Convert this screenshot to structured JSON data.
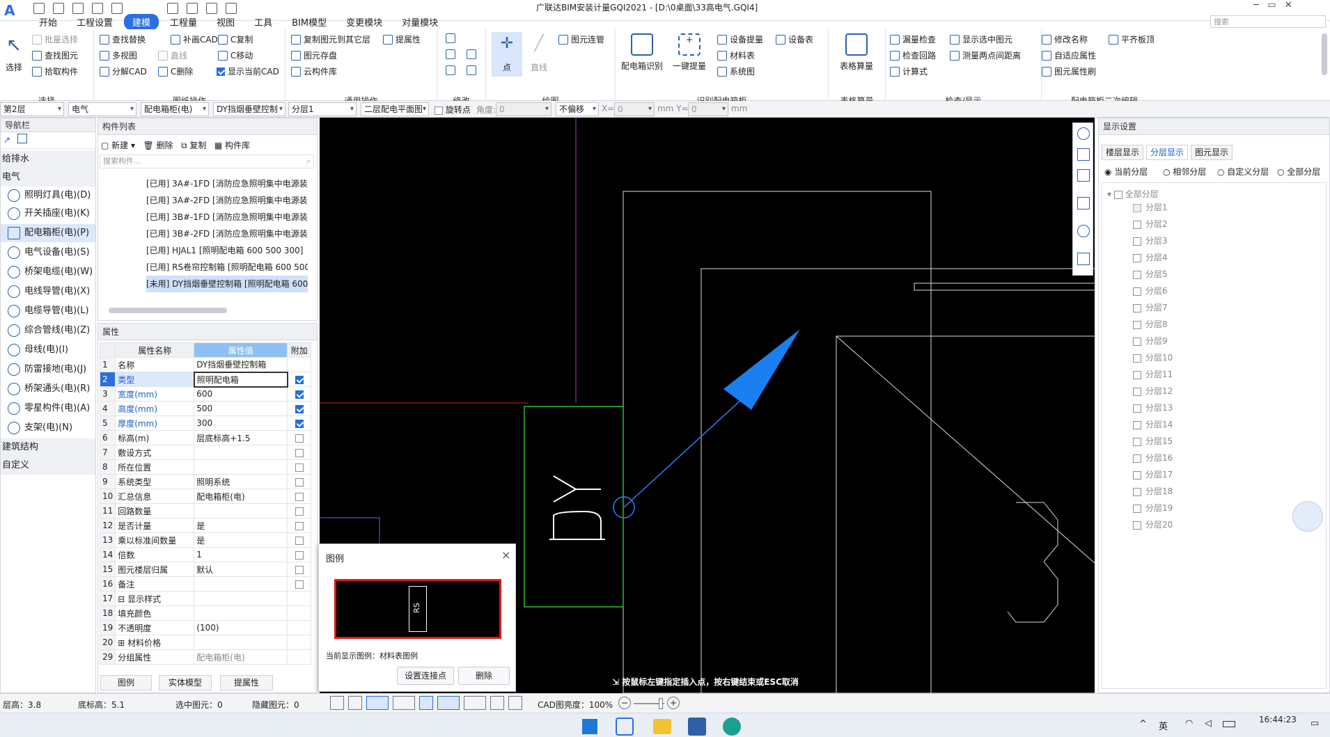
{
  "app": {
    "title": "广联达BIM安装计量GQI2021 - [D:\\0桌面\\33高电气.GQI4]",
    "search_placeholder": "搜索"
  },
  "menu": [
    "开始",
    "工程设置",
    "建模",
    "工程量",
    "视图",
    "工具",
    "BIM模型",
    "变更模块",
    "对量模块"
  ],
  "ribbon": {
    "select": {
      "big": "选择",
      "items": [
        "批量选择",
        "查找图元",
        "拾取构件"
      ],
      "label": "选择"
    },
    "drawing_ops": {
      "items": [
        "查找替换",
        "补画CAD",
        "C复制",
        "多视图",
        "直线",
        "C移动",
        "分解CAD",
        "C删除",
        "显示当前CAD"
      ],
      "label": "图纸操作"
    },
    "common_ops": {
      "items": [
        "复制图元到其它层",
        "提属性",
        "图元存盘",
        "云构件库"
      ],
      "label": "通用操作"
    },
    "modify": {
      "label": "修改"
    },
    "draw": {
      "point": "点",
      "line": "直线",
      "connect": "图元连管",
      "label": "绘图"
    },
    "identify": {
      "big1": "配电箱识别",
      "big2": "一键提量",
      "items": [
        "设备提量",
        "设备表",
        "材料表",
        "系统图"
      ],
      "label": "识别配电箱柜"
    },
    "table_calc": {
      "big": "表格算量",
      "label": "表格算量"
    },
    "check": {
      "items": [
        "漏量检查",
        "显示选中图元",
        "检查回路",
        "测量两点间距离",
        "计算式"
      ],
      "label": "检查/显示"
    },
    "edit2": {
      "items": [
        "修改名称",
        "平齐板顶",
        "自适应属性",
        "图元属性刷"
      ],
      "label": "配电箱柜二次编辑"
    }
  },
  "options": {
    "floor": "第2层",
    "discipline": "电气",
    "type": "配电箱柜(电)",
    "component": "DY挡烟垂壁控制",
    "layer": "分层1",
    "view": "二层配电平面图",
    "rotate_point": "旋转点",
    "angle_label": "角度:",
    "angle": "0",
    "offset": "不偏移",
    "x_label": "X=",
    "x": "0",
    "y_label": "mm Y=",
    "y": "0",
    "unit": "mm"
  },
  "nav": {
    "title": "导航栏",
    "groups": [
      "给排水",
      "电气",
      "建筑结构",
      "自定义"
    ],
    "items": [
      "照明灯具(电)(D)",
      "开关插座(电)(K)",
      "配电箱柜(电)(P)",
      "电气设备(电)(S)",
      "桥架电缆(电)(W)",
      "电线导管(电)(X)",
      "电缆导管(电)(L)",
      "综合管线(电)(Z)",
      "母线(电)(I)",
      "防雷接地(电)(J)",
      "桥架通头(电)(R)",
      "零星构件(电)(A)",
      "支架(电)(N)"
    ]
  },
  "components": {
    "title": "构件列表",
    "new": "新建",
    "delete": "删除",
    "copy": "复制",
    "library": "构件库",
    "search_placeholder": "搜索构件...",
    "items": [
      "[已用] 3A#-1FD [消防应急照明集中电源装",
      "[已用] 3A#-2FD [消防应急照明集中电源装",
      "[已用] 3B#-1FD [消防应急照明集中电源装",
      "[已用] 3B#-2FD [消防应急照明集中电源装",
      "[已用] HJAL1 [照明配电箱 600 500 300]",
      "[已用] RS卷帘控制箱 [照明配电箱 600 500",
      "[未用] DY挡烟垂壁控制箱 [照明配电箱 600"
    ]
  },
  "props": {
    "title": "属性",
    "headers": [
      "属性名称",
      "属性值",
      "附加"
    ],
    "rows": [
      {
        "n": "1",
        "name": "名称",
        "val": "DY挡烟垂壁控制箱",
        "cb": ""
      },
      {
        "n": "2",
        "name": "类型",
        "val": "照明配电箱",
        "cb": "on"
      },
      {
        "n": "3",
        "name": "宽度(mm)",
        "val": "600",
        "cb": "on"
      },
      {
        "n": "4",
        "name": "高度(mm)",
        "val": "500",
        "cb": "on"
      },
      {
        "n": "5",
        "name": "厚度(mm)",
        "val": "300",
        "cb": "on"
      },
      {
        "n": "6",
        "name": "标高(m)",
        "val": "层底标高+1.5",
        "cb": "off"
      },
      {
        "n": "7",
        "name": "敷设方式",
        "val": "",
        "cb": "off"
      },
      {
        "n": "8",
        "name": "所在位置",
        "val": "",
        "cb": "off"
      },
      {
        "n": "9",
        "name": "系统类型",
        "val": "照明系统",
        "cb": "off"
      },
      {
        "n": "10",
        "name": "汇总信息",
        "val": "配电箱柜(电)",
        "cb": "off"
      },
      {
        "n": "11",
        "name": "回路数量",
        "val": "",
        "cb": "off"
      },
      {
        "n": "12",
        "name": "是否计量",
        "val": "是",
        "cb": "off"
      },
      {
        "n": "13",
        "name": "乘以标准间数量",
        "val": "是",
        "cb": "off"
      },
      {
        "n": "14",
        "name": "倍数",
        "val": "1",
        "cb": "off"
      },
      {
        "n": "15",
        "name": "图元楼层归属",
        "val": "默认",
        "cb": "off"
      },
      {
        "n": "16",
        "name": "备注",
        "val": "",
        "cb": "off"
      },
      {
        "n": "17",
        "name": "⊟ 显示样式",
        "val": "",
        "cb": ""
      },
      {
        "n": "18",
        "name": "   填充颜色",
        "val": "",
        "cb": ""
      },
      {
        "n": "19",
        "name": "   不透明度",
        "val": "(100)",
        "cb": ""
      },
      {
        "n": "20",
        "name": "⊞ 材料价格",
        "val": "",
        "cb": ""
      },
      {
        "n": "29",
        "name": "分组属性",
        "val": "配电箱柜(电)",
        "cb": ""
      }
    ],
    "fill_color": "#8080f0",
    "bottom_tabs": [
      "图例",
      "实体模型",
      "提属性"
    ]
  },
  "legend_dialog": {
    "title": "图例",
    "close": "×",
    "symbol_text": "RS",
    "current": "当前显示图例：材料表图例",
    "set_point": "设置连接点",
    "delete": "删除"
  },
  "canvas": {
    "prompt": "按鼠标左键指定插入点，按右键结束或ESC取消"
  },
  "display": {
    "title": "显示设置",
    "tabs": [
      "楼层显示",
      "分层显示",
      "图元显示"
    ],
    "radios": [
      "当前分层",
      "相邻分层",
      "自定义分层",
      "全部分层"
    ],
    "root": "全部分层",
    "layers": [
      "分层1",
      "分层2",
      "分层3",
      "分层4",
      "分层5",
      "分层6",
      "分层7",
      "分层8",
      "分层9",
      "分层10",
      "分层11",
      "分层12",
      "分层13",
      "分层14",
      "分层15",
      "分层16",
      "分层17",
      "分层18",
      "分层19",
      "分层20"
    ]
  },
  "status": {
    "floor_height": "层高：3.8",
    "bottom_elev": "底标高：5.1",
    "selected": "选中图元：0",
    "hidden": "隐藏图元：0",
    "cad_brightness": "CAD图亮度：100%"
  },
  "taskbar": {
    "time": "16:44:23",
    "lang": "英"
  }
}
